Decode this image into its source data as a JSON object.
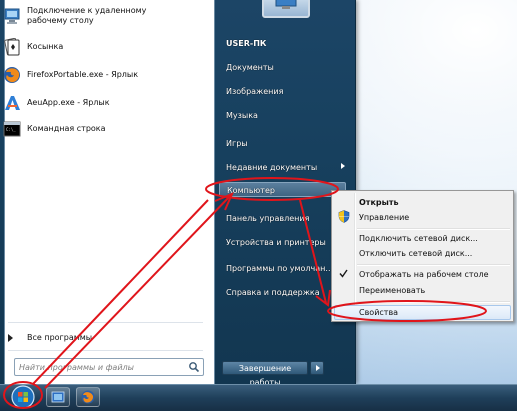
{
  "colors": {
    "annotation_red": "#e0151b",
    "start_menu_bg": "#17405e",
    "selection_blue": "#a8c8ec",
    "taskbar": "#1f3f5a"
  },
  "left_panel": {
    "programs": [
      {
        "label": "Подключение к удаленному рабочему столу",
        "icon": "remote-desktop-icon"
      },
      {
        "label": "Косынка",
        "icon": "solitaire-icon"
      },
      {
        "label": "FirefoxPortable.exe - Ярлык",
        "icon": "firefox-icon"
      },
      {
        "label": "AeuApp.exe - Ярлык",
        "icon": "app-icon"
      },
      {
        "label": "Командная строка",
        "icon": "cmd-icon"
      }
    ],
    "all_programs": "Все программы",
    "search_placeholder": "Найти программы и файлы"
  },
  "right_panel": {
    "items": [
      "USER-ПК",
      "Документы",
      "Изображения",
      "Музыка",
      "Игры",
      "Недавние документы",
      "Компьютер",
      "Панель управления",
      "Устройства и принтеры",
      "Программы по умолчан...",
      "Справка и поддержка"
    ],
    "shutdown": "Завершение работы"
  },
  "context_menu": {
    "items": [
      {
        "label": "Открыть",
        "bold": true
      },
      {
        "label": "Управление",
        "icon": "shield-icon"
      },
      {
        "label": "Подключить сетевой диск..."
      },
      {
        "label": "Отключить сетевой диск..."
      },
      {
        "label": "Отображать на рабочем столе",
        "checked": true
      },
      {
        "label": "Переименовать"
      },
      {
        "label": "Свойства",
        "selected": true
      }
    ]
  },
  "taskbar": {
    "pinned": [
      "explorer-icon",
      "firefox-icon"
    ]
  }
}
